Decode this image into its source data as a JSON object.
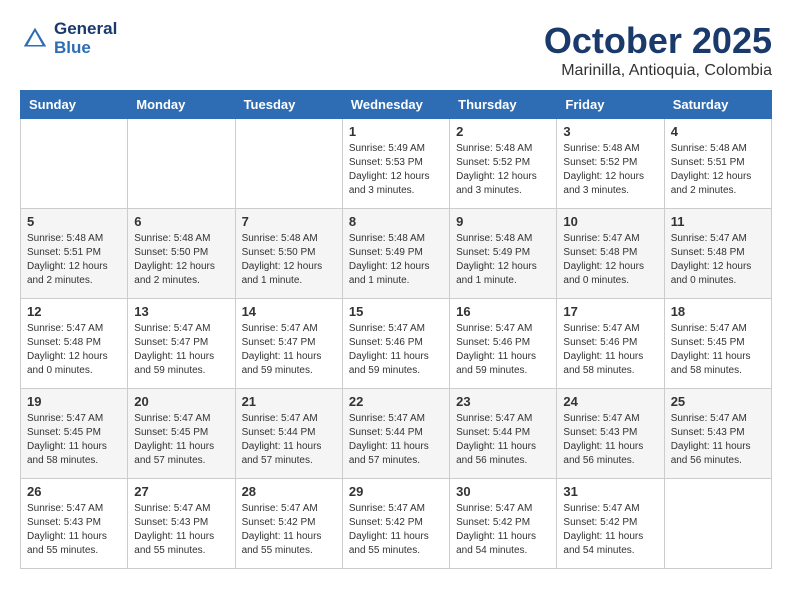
{
  "header": {
    "logo_line1": "General",
    "logo_line2": "Blue",
    "month": "October 2025",
    "location": "Marinilla, Antioquia, Colombia"
  },
  "days_of_week": [
    "Sunday",
    "Monday",
    "Tuesday",
    "Wednesday",
    "Thursday",
    "Friday",
    "Saturday"
  ],
  "weeks": [
    [
      {
        "day": "",
        "info": ""
      },
      {
        "day": "",
        "info": ""
      },
      {
        "day": "",
        "info": ""
      },
      {
        "day": "1",
        "info": "Sunrise: 5:49 AM\nSunset: 5:53 PM\nDaylight: 12 hours\nand 3 minutes."
      },
      {
        "day": "2",
        "info": "Sunrise: 5:48 AM\nSunset: 5:52 PM\nDaylight: 12 hours\nand 3 minutes."
      },
      {
        "day": "3",
        "info": "Sunrise: 5:48 AM\nSunset: 5:52 PM\nDaylight: 12 hours\nand 3 minutes."
      },
      {
        "day": "4",
        "info": "Sunrise: 5:48 AM\nSunset: 5:51 PM\nDaylight: 12 hours\nand 2 minutes."
      }
    ],
    [
      {
        "day": "5",
        "info": "Sunrise: 5:48 AM\nSunset: 5:51 PM\nDaylight: 12 hours\nand 2 minutes."
      },
      {
        "day": "6",
        "info": "Sunrise: 5:48 AM\nSunset: 5:50 PM\nDaylight: 12 hours\nand 2 minutes."
      },
      {
        "day": "7",
        "info": "Sunrise: 5:48 AM\nSunset: 5:50 PM\nDaylight: 12 hours\nand 1 minute."
      },
      {
        "day": "8",
        "info": "Sunrise: 5:48 AM\nSunset: 5:49 PM\nDaylight: 12 hours\nand 1 minute."
      },
      {
        "day": "9",
        "info": "Sunrise: 5:48 AM\nSunset: 5:49 PM\nDaylight: 12 hours\nand 1 minute."
      },
      {
        "day": "10",
        "info": "Sunrise: 5:47 AM\nSunset: 5:48 PM\nDaylight: 12 hours\nand 0 minutes."
      },
      {
        "day": "11",
        "info": "Sunrise: 5:47 AM\nSunset: 5:48 PM\nDaylight: 12 hours\nand 0 minutes."
      }
    ],
    [
      {
        "day": "12",
        "info": "Sunrise: 5:47 AM\nSunset: 5:48 PM\nDaylight: 12 hours\nand 0 minutes."
      },
      {
        "day": "13",
        "info": "Sunrise: 5:47 AM\nSunset: 5:47 PM\nDaylight: 11 hours\nand 59 minutes."
      },
      {
        "day": "14",
        "info": "Sunrise: 5:47 AM\nSunset: 5:47 PM\nDaylight: 11 hours\nand 59 minutes."
      },
      {
        "day": "15",
        "info": "Sunrise: 5:47 AM\nSunset: 5:46 PM\nDaylight: 11 hours\nand 59 minutes."
      },
      {
        "day": "16",
        "info": "Sunrise: 5:47 AM\nSunset: 5:46 PM\nDaylight: 11 hours\nand 59 minutes."
      },
      {
        "day": "17",
        "info": "Sunrise: 5:47 AM\nSunset: 5:46 PM\nDaylight: 11 hours\nand 58 minutes."
      },
      {
        "day": "18",
        "info": "Sunrise: 5:47 AM\nSunset: 5:45 PM\nDaylight: 11 hours\nand 58 minutes."
      }
    ],
    [
      {
        "day": "19",
        "info": "Sunrise: 5:47 AM\nSunset: 5:45 PM\nDaylight: 11 hours\nand 58 minutes."
      },
      {
        "day": "20",
        "info": "Sunrise: 5:47 AM\nSunset: 5:45 PM\nDaylight: 11 hours\nand 57 minutes."
      },
      {
        "day": "21",
        "info": "Sunrise: 5:47 AM\nSunset: 5:44 PM\nDaylight: 11 hours\nand 57 minutes."
      },
      {
        "day": "22",
        "info": "Sunrise: 5:47 AM\nSunset: 5:44 PM\nDaylight: 11 hours\nand 57 minutes."
      },
      {
        "day": "23",
        "info": "Sunrise: 5:47 AM\nSunset: 5:44 PM\nDaylight: 11 hours\nand 56 minutes."
      },
      {
        "day": "24",
        "info": "Sunrise: 5:47 AM\nSunset: 5:43 PM\nDaylight: 11 hours\nand 56 minutes."
      },
      {
        "day": "25",
        "info": "Sunrise: 5:47 AM\nSunset: 5:43 PM\nDaylight: 11 hours\nand 56 minutes."
      }
    ],
    [
      {
        "day": "26",
        "info": "Sunrise: 5:47 AM\nSunset: 5:43 PM\nDaylight: 11 hours\nand 55 minutes."
      },
      {
        "day": "27",
        "info": "Sunrise: 5:47 AM\nSunset: 5:43 PM\nDaylight: 11 hours\nand 55 minutes."
      },
      {
        "day": "28",
        "info": "Sunrise: 5:47 AM\nSunset: 5:42 PM\nDaylight: 11 hours\nand 55 minutes."
      },
      {
        "day": "29",
        "info": "Sunrise: 5:47 AM\nSunset: 5:42 PM\nDaylight: 11 hours\nand 55 minutes."
      },
      {
        "day": "30",
        "info": "Sunrise: 5:47 AM\nSunset: 5:42 PM\nDaylight: 11 hours\nand 54 minutes."
      },
      {
        "day": "31",
        "info": "Sunrise: 5:47 AM\nSunset: 5:42 PM\nDaylight: 11 hours\nand 54 minutes."
      },
      {
        "day": "",
        "info": ""
      }
    ]
  ]
}
